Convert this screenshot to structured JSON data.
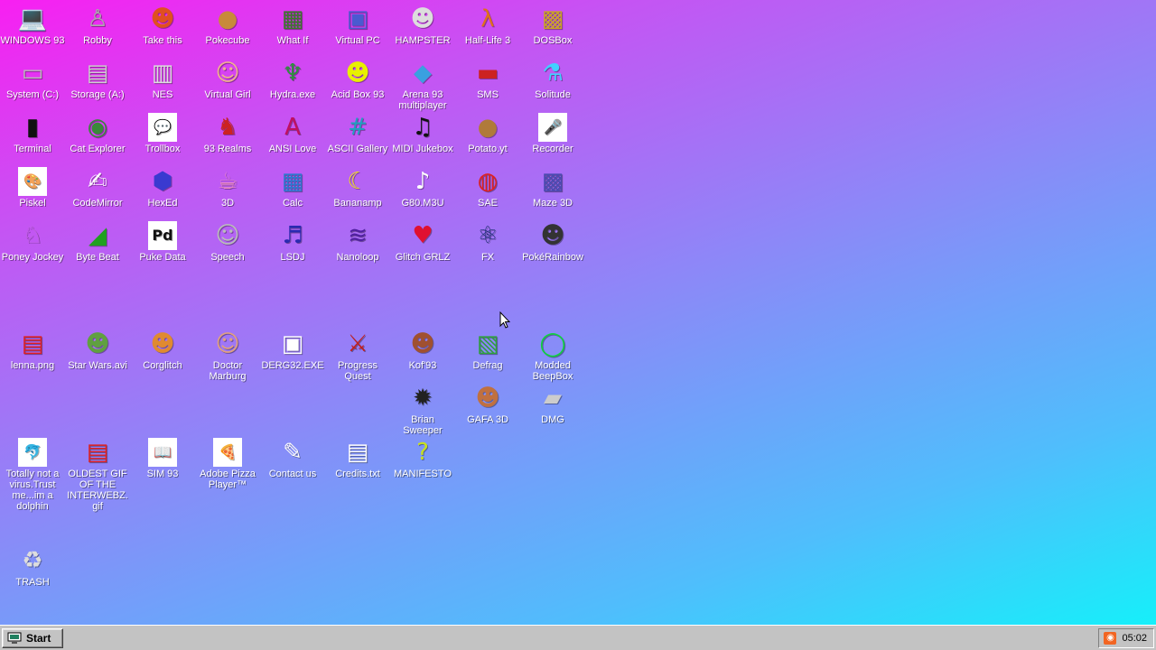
{
  "desktop_icons": [
    {
      "label": "WINDOWS 93",
      "icon": "computer-icon",
      "glyph": "💻",
      "color": "#444444"
    },
    {
      "label": "Robby",
      "icon": "robot-icon",
      "glyph": "♙",
      "color": "#aaaaaa"
    },
    {
      "label": "Take this",
      "icon": "warrior-icon",
      "glyph": "☻",
      "color": "#e05020"
    },
    {
      "label": "Pokecube",
      "icon": "cookie-cube-icon",
      "glyph": "●",
      "color": "#c88a3a"
    },
    {
      "label": "What If",
      "icon": "green-grid-icon",
      "glyph": "▦",
      "color": "#3a7a2a"
    },
    {
      "label": "Virtual PC",
      "icon": "window-icon",
      "glyph": "▣",
      "color": "#4a5ad0"
    },
    {
      "label": "HAMPSTER",
      "icon": "hamster-icon",
      "glyph": "☻",
      "color": "#dddddd"
    },
    {
      "label": "Half-Life 3",
      "icon": "lambda-icon",
      "glyph": "λ",
      "color": "#e0701a"
    },
    {
      "label": "DOSBox",
      "icon": "dosbox-icon",
      "glyph": "▩",
      "color": "#c9a227"
    },
    {
      "label": "System (C:)",
      "icon": "hard-drive-icon",
      "glyph": "▭",
      "color": "#bbbbbb"
    },
    {
      "label": "Storage (A:)",
      "icon": "floppy-drive-icon",
      "glyph": "▤",
      "color": "#cccccc"
    },
    {
      "label": "NES",
      "icon": "nes-console-icon",
      "glyph": "▥",
      "color": "#dddddd"
    },
    {
      "label": "Virtual Girl",
      "icon": "virtual-girl-icon",
      "glyph": "☺",
      "color": "#f0b090"
    },
    {
      "label": "Hydra.exe",
      "icon": "hydra-icon",
      "glyph": "♆",
      "color": "#2f8f3f"
    },
    {
      "label": "Acid Box 93",
      "icon": "smiley-icon",
      "glyph": "☻",
      "color": "#e8f000"
    },
    {
      "label": "Arena 93 multiplayer",
      "icon": "cube-icon",
      "glyph": "◆",
      "color": "#3aa0e0"
    },
    {
      "label": "SMS",
      "icon": "sms-console-icon",
      "glyph": "▬",
      "color": "#cc2222"
    },
    {
      "label": "Solitude",
      "icon": "bottle-icon",
      "glyph": "⚗",
      "color": "#40d0ff"
    },
    {
      "label": "Terminal",
      "icon": "terminal-icon",
      "glyph": "▮",
      "color": "#111111"
    },
    {
      "label": "Cat Explorer",
      "icon": "globe-cat-icon",
      "glyph": "◉",
      "color": "#3a8a3a"
    },
    {
      "label": "Trollbox",
      "icon": "chat-bubble-icon",
      "glyph": "💬",
      "color": "#50c8ff"
    },
    {
      "label": "93 Realms",
      "icon": "knight-icon",
      "glyph": "♞",
      "color": "#cc2222"
    },
    {
      "label": "ANSI Love",
      "icon": "ansi-letter-icon",
      "glyph": "A",
      "color": "#c01060"
    },
    {
      "label": "ASCII Gallery",
      "icon": "ascii-123-icon",
      "glyph": "#",
      "color": "#20a0c0"
    },
    {
      "label": "MIDI Jukebox",
      "icon": "piano-keys-icon",
      "glyph": "♫",
      "color": "#111111"
    },
    {
      "label": "Potato.yt",
      "icon": "potato-icon",
      "glyph": "●",
      "color": "#b07a3a"
    },
    {
      "label": "Recorder",
      "icon": "microphone-icon",
      "glyph": "🎤",
      "color": "#666666"
    },
    {
      "label": "Piskel",
      "icon": "palette-icon",
      "glyph": "🎨",
      "color": "#e0b050"
    },
    {
      "label": "CodeMirror",
      "icon": "code-mirror-icon",
      "glyph": "✍",
      "color": "#ffffff"
    },
    {
      "label": "HexEd",
      "icon": "hexagon-icon",
      "glyph": "⬢",
      "color": "#3a3ad0"
    },
    {
      "label": "3D",
      "icon": "teapot-icon",
      "glyph": "☕",
      "color": "#f090c0"
    },
    {
      "label": "Calc",
      "icon": "calculator-icon",
      "glyph": "▦",
      "color": "#2a7ad0"
    },
    {
      "label": "Bananamp",
      "icon": "banana-icon",
      "glyph": "☾",
      "color": "#f0e020"
    },
    {
      "label": "G80.M3U",
      "icon": "speaker-icon",
      "glyph": "♪",
      "color": "#ffffff"
    },
    {
      "label": "SAE",
      "icon": "checkered-ball-icon",
      "glyph": "◍",
      "color": "#e02020"
    },
    {
      "label": "Maze 3D",
      "icon": "maze-icon",
      "glyph": "▩",
      "color": "#4a4ab0"
    },
    {
      "label": "Poney Jockey",
      "icon": "pony-icon",
      "glyph": "♘",
      "color": "#c060e0"
    },
    {
      "label": "Byte Beat",
      "icon": "byte-beat-icon",
      "glyph": "◢",
      "color": "#20a020"
    },
    {
      "label": "Puke Data",
      "icon": "puredata-icon",
      "glyph": "Pd",
      "color": "#111111"
    },
    {
      "label": "Speech",
      "icon": "speech-face-icon",
      "glyph": "☺",
      "color": "#bbbbbb"
    },
    {
      "label": "LSDJ",
      "icon": "lsdj-icon",
      "glyph": "♬",
      "color": "#2a2ab0"
    },
    {
      "label": "Nanoloop",
      "icon": "waveform-icon",
      "glyph": "≋",
      "color": "#5020a0"
    },
    {
      "label": "Glitch GRLZ",
      "icon": "lips-icon",
      "glyph": "♥",
      "color": "#e01030"
    },
    {
      "label": "FX",
      "icon": "atom-icon",
      "glyph": "⚛",
      "color": "#20307a"
    },
    {
      "label": "PokéRainbow",
      "icon": "pixel-people-icon",
      "glyph": "☻",
      "color": "#333333"
    },
    {
      "label": "lenna.png",
      "icon": "image-file-icon",
      "glyph": "▤",
      "color": "#e02020"
    },
    {
      "label": "Star Wars.avi",
      "icon": "yoda-icon",
      "glyph": "☻",
      "color": "#60a040"
    },
    {
      "label": "Corglitch",
      "icon": "corgi-icon",
      "glyph": "☻",
      "color": "#e08a30"
    },
    {
      "label": "Doctor Marburg",
      "icon": "doctor-icon",
      "glyph": "☺",
      "color": "#e0a080"
    },
    {
      "label": "DERG32.EXE",
      "icon": "derg-monitor-icon",
      "glyph": "▣",
      "color": "#ffffff"
    },
    {
      "label": "Progress Quest",
      "icon": "crossed-swords-icon",
      "glyph": "⚔",
      "color": "#c02020"
    },
    {
      "label": "Kof'93",
      "icon": "fighter-portrait-icon",
      "glyph": "☻",
      "color": "#a05030"
    },
    {
      "label": "Defrag",
      "icon": "defrag-cube-icon",
      "glyph": "▧",
      "color": "#30a040"
    },
    {
      "label": "Modded BeepBox",
      "icon": "green-ring-icon",
      "glyph": "◯",
      "color": "#10d040"
    },
    {
      "label": "Brian Sweeper",
      "icon": "mine-icon",
      "glyph": "✹",
      "color": "#222222"
    },
    {
      "label": "GAFA 3D",
      "icon": "doom-face-icon",
      "glyph": "☻",
      "color": "#c07040"
    },
    {
      "label": "DMG",
      "icon": "gameboy-cart-icon",
      "glyph": "▰",
      "color": "#cccccc"
    },
    {
      "label": "Totally not a virus.Trust me...im a dolphin",
      "icon": "dolphin-icon",
      "glyph": "🐬",
      "color": "#3aa0e0"
    },
    {
      "label": "OLDEST GIF OF THE INTERWEBZ.gif",
      "icon": "gif-file-icon",
      "glyph": "▤",
      "color": "#e02020"
    },
    {
      "label": "SIM 93",
      "icon": "sim-book-icon",
      "glyph": "📖",
      "color": "#eeeeee"
    },
    {
      "label": "Adobe Pizza Player™",
      "icon": "pizza-icon",
      "glyph": "🍕",
      "color": "#e0a030"
    },
    {
      "label": "Contact us",
      "icon": "contact-form-icon",
      "glyph": "✎",
      "color": "#ffffff"
    },
    {
      "label": "Credits.txt",
      "icon": "text-file-icon",
      "glyph": "▤",
      "color": "#ffffff"
    },
    {
      "label": "MANIFESTO",
      "icon": "question-mark-icon",
      "glyph": "?",
      "color": "#c8e020"
    },
    {
      "label": "TRASH",
      "icon": "recycle-bin-icon",
      "glyph": "♻",
      "color": "#dddddd"
    }
  ],
  "taskbar": {
    "start_label": "Start",
    "clock": "05:02",
    "tray_icon": "rss-icon"
  }
}
